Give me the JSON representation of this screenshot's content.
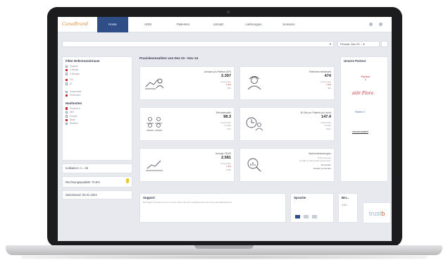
{
  "nav": {
    "logo_a": "CanaBrand",
    "logo_b": "",
    "tabs": [
      "Home",
      "ADM",
      "Patienten",
      "Umsatz",
      "Lieferungen",
      "Konsens"
    ],
    "active_tab": 0
  },
  "toolbar": {
    "period_label": "Periode: Dez 23 ... ▾"
  },
  "filters": {
    "title": "Filter Referenzzeitraum",
    "group1": [
      {
        "label": "Quartal",
        "on": false
      },
      {
        "label": "1 Monat",
        "on": true
      },
      {
        "label": "3 Monate",
        "on": false
      }
    ],
    "group2": [
      {
        "label": "CE",
        "on": true
      },
      {
        "label": "EI",
        "on": false
      }
    ],
    "group3": [
      {
        "label": "Vorperiode",
        "on": false
      },
      {
        "label": "Promotion",
        "on": true
      }
    ],
    "product_title": "Hanfsorten",
    "group4": [
      {
        "label": "Produkt A",
        "on": true
      },
      {
        "label": "IBIS",
        "on": false
      },
      {
        "label": "Extrakt",
        "on": false
      },
      {
        "label": "Blüte",
        "on": true
      },
      {
        "label": "Weitere",
        "on": false
      }
    ]
  },
  "info": {
    "line1": "Indikation: n = 46",
    "line2": "Rechnungsqualität: 70.6%",
    "line3": "Datenstand: 03.01.2024"
  },
  "kpi": {
    "title": "Praxiskennzahlen von Dez 23 - Nov 24",
    "cards": [
      {
        "title": "Umsatz pro Patient (GP)",
        "value": "2.397",
        "sub1": "Vorperiode",
        "sub2": "1.6%",
        "sub3": "550",
        "icon": "chart-person-icon"
      },
      {
        "title": "Patienten behandelt",
        "value": "474",
        "sub1": "Vorperiode",
        "sub2": "7.0%",
        "sub3": "452",
        "icon": "nurse-icon"
      },
      {
        "title": "Rezeptanzahl",
        "value": "98.3",
        "sub1": "Vorperiode",
        "sub2": "Anzahl",
        "sub3": "35.4",
        "icon": "group-icon"
      },
      {
        "title": "Ø-Zeit pro Patient p/m (min)",
        "value": "147.4",
        "sub1": "Vorperiode",
        "sub2": "Anzahl",
        "sub3": "168.0",
        "icon": "clock-person-icon"
      },
      {
        "title": "Umsatz TEUR",
        "value": "2.581",
        "sub1": "Vorperiode",
        "sub2": "7.1%",
        "sub3": "1.966",
        "icon": "line-chart-icon"
      },
      {
        "title": "Spitzenbewertungen",
        "value": "",
        "sub1": "Listungsquote",
        "sub2": "Kanäle im Betrachtungszeitraum",
        "sub3": "Promotion",
        "sub4": "Kanäle promoviert",
        "icon": "magnifier-chart-icon"
      }
    ]
  },
  "partners": {
    "title": "Unsere Partner",
    "items": [
      "Partner 1",
      "stör Flora",
      "Partner 3",
      "relevanzbasiert"
    ]
  },
  "support": {
    "title": "Support",
    "text": "Bei Fragen schreiben Sie uns an oder nutzen Sie das Kontaktformular unter www.praxisdashboard.de"
  },
  "lang": {
    "title": "Sprache",
    "flags": [
      "de",
      "en",
      "fr"
    ]
  },
  "mini": {
    "title": "Ber...",
    "value": "4.9.0"
  },
  "trust_logo": {
    "a": "trust",
    "b": "b"
  }
}
